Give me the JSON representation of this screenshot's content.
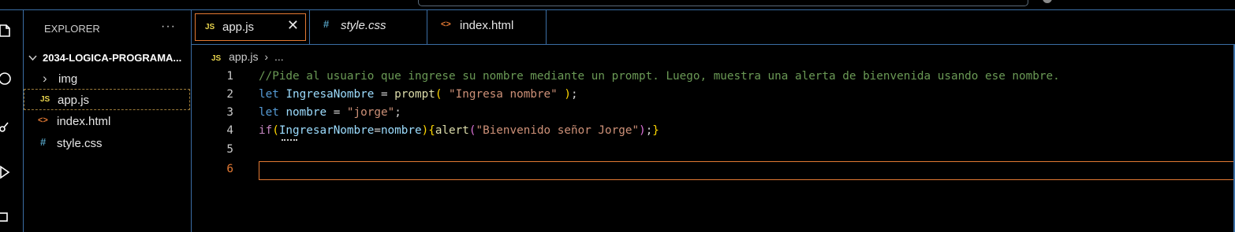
{
  "sidebar": {
    "title": "EXPLORER",
    "more": "···",
    "folder": "2034-LOGICA-PROGRAMA...",
    "items": [
      {
        "label": "img",
        "icon": "chevron-right-icon",
        "glyph": "›"
      },
      {
        "label": "app.js",
        "icon": "js-file-icon",
        "glyph": "JS"
      },
      {
        "label": "index.html",
        "icon": "html-file-icon",
        "glyph": "<>"
      },
      {
        "label": "style.css",
        "icon": "css-file-icon",
        "glyph": "#"
      }
    ]
  },
  "tabs": [
    {
      "label": "app.js",
      "glyph": "JS",
      "close": "✕"
    },
    {
      "label": "style.css",
      "glyph": "#"
    },
    {
      "label": "index.html",
      "glyph": "<>"
    }
  ],
  "breadcrumb": {
    "glyph": "JS",
    "file": "app.js",
    "sep": "›",
    "rest": "..."
  },
  "editor": {
    "line_numbers": [
      "1",
      "2",
      "3",
      "4",
      "5",
      "6"
    ],
    "line1": "//Pide al usuario que ingrese su nombre mediante un prompt. Luego, muestra una alerta de bienvenida usando ese nombre.",
    "line2": {
      "kw": "let",
      "var": "IngresaNombre",
      "eq": " = ",
      "fn": "prompt",
      "open": "(",
      "str": " \"Ingresa nombre\" ",
      "close": ")",
      "end": ";"
    },
    "line3": {
      "kw": "let",
      "var": "nombre",
      "eq": " = ",
      "str": "\"jorge\"",
      "end": ";"
    },
    "line4": {
      "kw": "if",
      "open": "(",
      "v1": "IngresarNombre",
      "eq": "=",
      "v2": "nombre",
      "close": ")",
      "bopen": "{",
      "fn": "alert",
      "popen": "(",
      "str": "\"Bienvenido señor Jorge\"",
      "pclose": ")",
      "semi": ";",
      "bclose": "}"
    }
  },
  "colors": {
    "accent": "#e37933",
    "frame": "#3b6ea5",
    "comment": "#6a9955",
    "keyword": "#569cd6"
  }
}
